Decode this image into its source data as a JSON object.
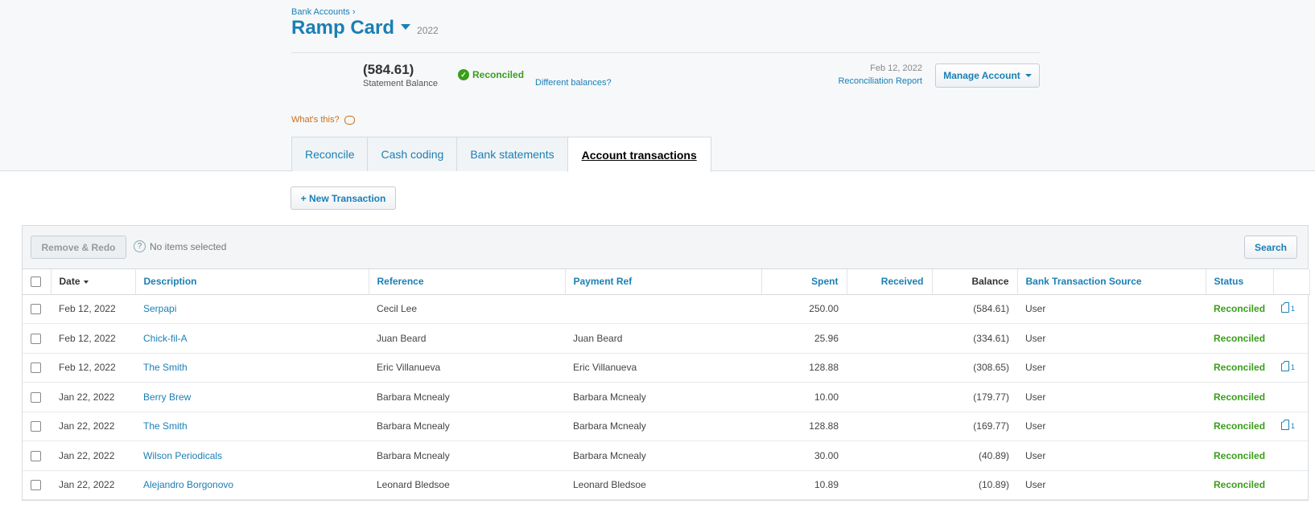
{
  "header": {
    "breadcrumb": "Bank Accounts ›",
    "title": "Ramp Card",
    "year": "2022",
    "statement_balance": "(584.61)",
    "statement_balance_label": "Statement Balance",
    "reconciled_label": "Reconciled",
    "different_balances": "Different balances?",
    "report_date": "Feb 12, 2022",
    "report_link": "Reconciliation Report",
    "manage_account": "Manage Account",
    "whats_this": "What's this?"
  },
  "tabs": [
    {
      "label": "Reconcile"
    },
    {
      "label": "Cash coding"
    },
    {
      "label": "Bank statements"
    },
    {
      "label": "Account transactions",
      "active": true
    }
  ],
  "actions": {
    "new_transaction": "+ New Transaction",
    "remove_redo": "Remove & Redo",
    "no_items": "No items selected",
    "search": "Search"
  },
  "columns": {
    "date": "Date",
    "description": "Description",
    "reference": "Reference",
    "payment_ref": "Payment Ref",
    "spent": "Spent",
    "received": "Received",
    "balance": "Balance",
    "source": "Bank Transaction Source",
    "status": "Status"
  },
  "rows": [
    {
      "date": "Feb 12, 2022",
      "description": "Serpapi",
      "reference": "Cecil Lee",
      "payment_ref": "",
      "spent": "250.00",
      "received": "",
      "balance": "(584.61)",
      "source": "User",
      "status": "Reconciled",
      "attachments": "1"
    },
    {
      "date": "Feb 12, 2022",
      "description": "Chick-fil-A",
      "reference": "Juan Beard",
      "payment_ref": "Juan Beard",
      "spent": "25.96",
      "received": "",
      "balance": "(334.61)",
      "source": "User",
      "status": "Reconciled",
      "attachments": ""
    },
    {
      "date": "Feb 12, 2022",
      "description": "The Smith",
      "reference": "Eric Villanueva",
      "payment_ref": "Eric Villanueva",
      "spent": "128.88",
      "received": "",
      "balance": "(308.65)",
      "source": "User",
      "status": "Reconciled",
      "attachments": "1"
    },
    {
      "date": "Jan 22, 2022",
      "description": "Berry Brew",
      "reference": "Barbara Mcnealy",
      "payment_ref": "Barbara Mcnealy",
      "spent": "10.00",
      "received": "",
      "balance": "(179.77)",
      "source": "User",
      "status": "Reconciled",
      "attachments": ""
    },
    {
      "date": "Jan 22, 2022",
      "description": "The Smith",
      "reference": "Barbara Mcnealy",
      "payment_ref": "Barbara Mcnealy",
      "spent": "128.88",
      "received": "",
      "balance": "(169.77)",
      "source": "User",
      "status": "Reconciled",
      "attachments": "1"
    },
    {
      "date": "Jan 22, 2022",
      "description": "Wilson Periodicals",
      "reference": "Barbara Mcnealy",
      "payment_ref": "Barbara Mcnealy",
      "spent": "30.00",
      "received": "",
      "balance": "(40.89)",
      "source": "User",
      "status": "Reconciled",
      "attachments": ""
    },
    {
      "date": "Jan 22, 2022",
      "description": "Alejandro Borgonovo",
      "reference": "Leonard Bledsoe",
      "payment_ref": "Leonard Bledsoe",
      "spent": "10.89",
      "received": "",
      "balance": "(10.89)",
      "source": "User",
      "status": "Reconciled",
      "attachments": ""
    }
  ]
}
